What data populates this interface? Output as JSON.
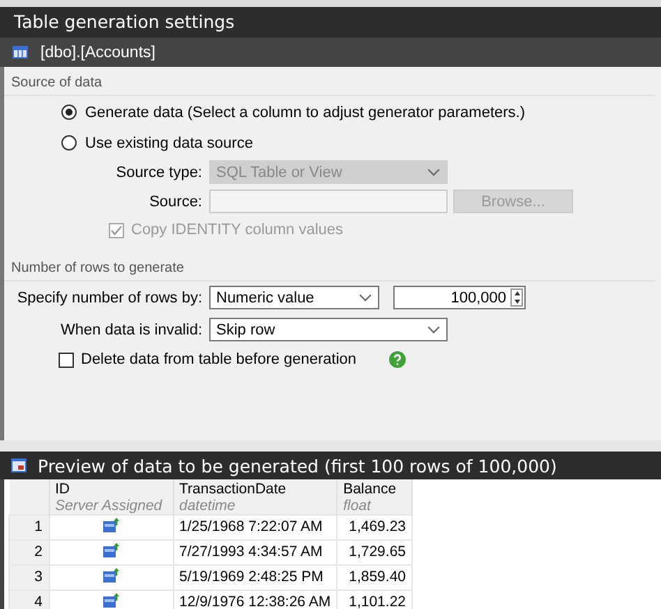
{
  "window": {
    "title": "Table generation settings"
  },
  "table_header": {
    "name": "[dbo].[Accounts]"
  },
  "source_of_data": {
    "title": "Source of data",
    "options": [
      {
        "label": "Generate data (Select a column to adjust generator parameters.)",
        "selected": true
      },
      {
        "label": "Use existing data source",
        "selected": false
      }
    ],
    "source_type": {
      "label": "Source type:",
      "value": "SQL Table or View",
      "disabled": true
    },
    "source": {
      "label": "Source:",
      "disabled": true
    },
    "browse_button": {
      "label": "Browse...",
      "disabled": true
    },
    "copy_identity": {
      "label": "Copy IDENTITY column values",
      "checked": true,
      "disabled": true
    }
  },
  "rows_to_generate": {
    "title": "Number of rows to generate",
    "specify_by": {
      "label": "Specify number of rows by:",
      "value": "Numeric value"
    },
    "row_count": {
      "value": "100,000"
    },
    "when_invalid": {
      "label": "When data is invalid:",
      "value": "Skip row"
    },
    "delete_before": {
      "label": "Delete data from table before generation",
      "checked": false
    }
  },
  "preview": {
    "title": "Preview of data to be generated (first 100 rows of 100,000)",
    "columns": [
      {
        "name": "ID",
        "type": "Server Assigned",
        "kind": "icon"
      },
      {
        "name": "TransactionDate",
        "type": "datetime",
        "kind": "text"
      },
      {
        "name": "Balance",
        "type": "float",
        "kind": "number"
      }
    ],
    "rows": [
      {
        "number": "1",
        "cells": [
          "",
          "1/25/1968 7:22:07 AM",
          "1,469.23"
        ]
      },
      {
        "number": "2",
        "cells": [
          "",
          "7/27/1993 4:34:57 AM",
          "1,729.65"
        ]
      },
      {
        "number": "3",
        "cells": [
          "",
          "5/19/1969 2:48:25 PM",
          "1,859.40"
        ]
      },
      {
        "number": "4",
        "cells": [
          "",
          "12/9/1976 12:38:26 AM",
          "1,101.22"
        ]
      }
    ]
  }
}
